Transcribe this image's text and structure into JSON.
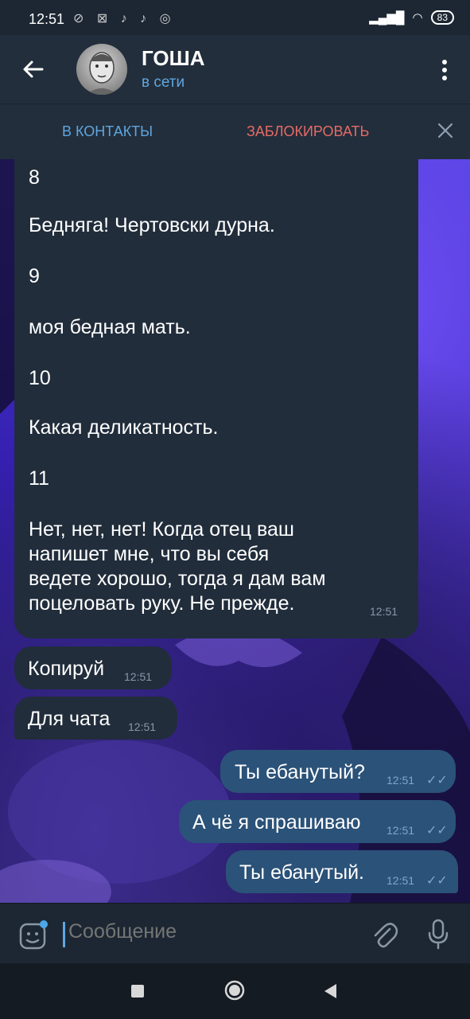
{
  "status": {
    "time": "12:51",
    "icons": "⊘ ⊠ ♪ ♪ ◎",
    "battery": "83"
  },
  "header": {
    "title": "ГОША",
    "subtitle": "в сети"
  },
  "actions": {
    "contacts": "В КОНТАКТЫ",
    "block": "ЗАБЛОКИРОВАТЬ"
  },
  "messages": {
    "big": {
      "lines": [
        "8",
        "Бедняга! Чертовски дурна.",
        "9",
        "моя бедная мать.",
        "10",
        "Какая деликатность.",
        "11",
        "Нет, нет, нет! Когда отец ваш",
        "напишет мне, что вы себя",
        "ведете хорошо, тогда я дам вам",
        "поцеловать руку. Не прежде."
      ],
      "time": "12:51"
    },
    "in1": {
      "text": "Копируй",
      "time": "12:51"
    },
    "in2": {
      "text": "Для чата",
      "time": "12:51"
    },
    "out1": {
      "text": "Ты ебанутый?",
      "time": "12:51"
    },
    "out2": {
      "text": "А чё я спрашиваю",
      "time": "12:51"
    },
    "out3": {
      "text": "Ты ебанутый.",
      "time": "12:51"
    }
  },
  "composer": {
    "placeholder": "Сообщение"
  },
  "colors": {
    "accent": "#5fa6e0",
    "danger": "#e66a66",
    "incoming": "#212d3b",
    "outgoing": "#2b5278"
  }
}
